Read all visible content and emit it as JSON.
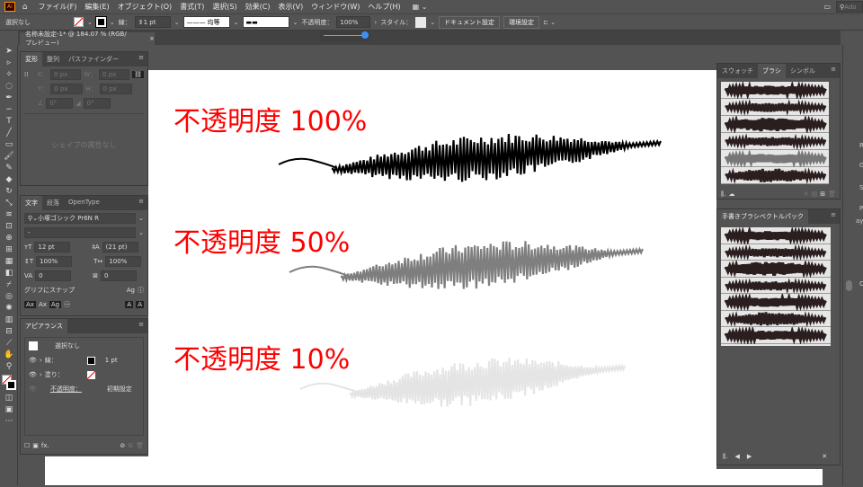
{
  "menubar": {
    "app_icon": "Ai",
    "items": [
      "ファイル(F)",
      "編集(E)",
      "オブジェクト(O)",
      "書式(T)",
      "選択(S)",
      "効果(C)",
      "表示(V)",
      "ウィンドウ(W)",
      "ヘルプ(H)"
    ],
    "search_placeholder": "Ado"
  },
  "control": {
    "selection": "選択なし",
    "stroke_label": "線：",
    "stroke_weight": "1 pt",
    "stroke_profile": "均等",
    "opacity_label": "不透明度：",
    "opacity": "100%",
    "style_label": "スタイル：",
    "document_setup": "ドキュメント設定",
    "preferences": "環境設定",
    "opacity_slider": 1.0
  },
  "document": {
    "tab_title": "名称未設定-1* @ 184.07 % (RGB/プレビュー)",
    "close": "×"
  },
  "transform_panel": {
    "tabs": [
      "変形",
      "整列",
      "パスファインダー"
    ],
    "x_label": "X：",
    "y_label": "Y：",
    "w_label": "W：",
    "h_label": "H：",
    "x": "0 px",
    "y": "0 px",
    "w": "0 px",
    "h": "0 px",
    "angle": "0°",
    "shear": "0°",
    "empty_msg": "シェイプの属性なし"
  },
  "character_panel": {
    "tabs": [
      "文字",
      "段落",
      "OpenType"
    ],
    "font": "小塚ゴシック Pr6N R",
    "style": "-",
    "size": "12 pt",
    "leading": "(21 pt)",
    "vscale": "100%",
    "hscale": "100%",
    "kerning": "0",
    "tracking": "0",
    "snap_label": "グリフにスナップ"
  },
  "appearance_panel": {
    "tab": "アピアランス",
    "selection": "選択なし",
    "stroke_label": "線：",
    "stroke_value": "1 pt",
    "fill_label": "塗り：",
    "opacity_label": "不透明度：",
    "opacity_value": "初期設定"
  },
  "swatch_panel": {
    "tabs": [
      "スウォッチ",
      "ブラシ",
      "シンボル"
    ]
  },
  "vector_pack_panel": {
    "title": "手書きブラシベクトルパック"
  },
  "right_strip": {
    "labels": [
      "Re",
      "G",
      "S",
      "P",
      "ayb",
      "O"
    ]
  },
  "canvas": {
    "samples": [
      {
        "label": "不透明度 100%",
        "opacity": 1.0,
        "color": "#000000"
      },
      {
        "label": "不透明度 50%",
        "opacity": 0.5,
        "color": "#000000"
      },
      {
        "label": "不透明度 10%",
        "opacity": 0.1,
        "color": "#000000"
      }
    ]
  },
  "colors": {
    "accent_red": "#ff0000",
    "ui_bg": "#535353",
    "slider": "#3d8ff5"
  }
}
